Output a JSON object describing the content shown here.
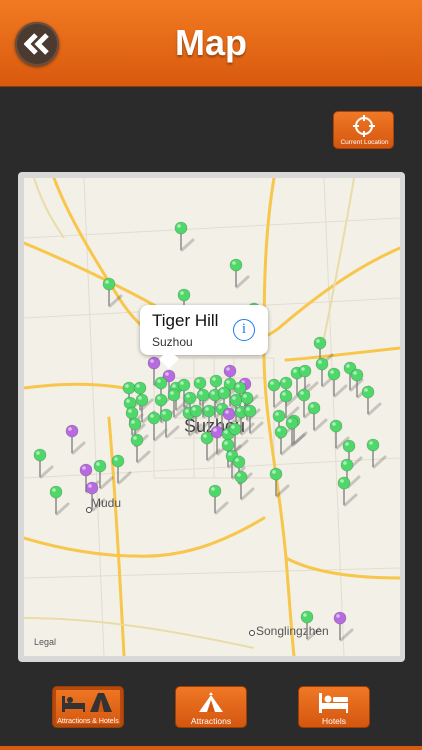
{
  "header": {
    "title": "Map",
    "back_icon": "double-chevron-left-icon"
  },
  "current_location": {
    "label": "Current Location",
    "icon": "crosshair-icon"
  },
  "map": {
    "callout": {
      "title": "Tiger Hill",
      "subtitle": "Suzhou",
      "info_icon": "info-icon",
      "info_glyph": "i"
    },
    "places": {
      "city": "Suzhou",
      "mudu": "Mudu",
      "songlingzhen": "Songlingzhen"
    },
    "legal": "Legal",
    "pin_colors": {
      "green": "#4fd86a",
      "purple": "#b66be0"
    }
  },
  "tabs": [
    {
      "label": "Attractions & Hotels",
      "icon": "bed-and-tent-icon",
      "active": true
    },
    {
      "label": "Attractions",
      "icon": "tent-icon",
      "active": false
    },
    {
      "label": "Hotels",
      "icon": "bed-icon",
      "active": false
    }
  ]
}
